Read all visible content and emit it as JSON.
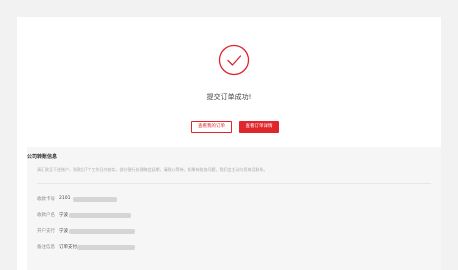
{
  "success": {
    "title": "提交订单成功!",
    "view_orders_label": "查看我的订单",
    "view_detail_label": "查看订单详情"
  },
  "info": {
    "title": "公司转账信息",
    "note": "请汇款至下述账户，到款后7个工作日内核实，部分银行处理略会延期，请耐心等待。如果有账务问题，我们会主动与您电话联系。",
    "rows": [
      {
        "label": "收款卡号",
        "value": "2101"
      },
      {
        "label": "收款户名",
        "value": "宁波"
      },
      {
        "label": "开户支行",
        "value": "宁波"
      },
      {
        "label": "备注信息",
        "value": "订单支付"
      }
    ]
  },
  "colors": {
    "accent": "#e0252b",
    "page_bg": "#f2f2f2",
    "info_bg": "#f6f6f6"
  },
  "icons": {
    "success": "check-circle-icon"
  }
}
